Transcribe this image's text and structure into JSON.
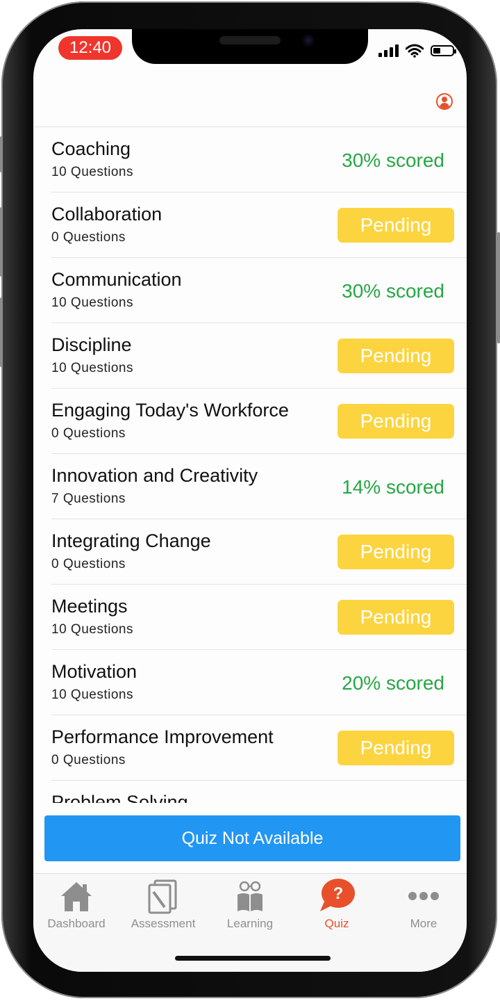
{
  "status_bar": {
    "time": "12:40"
  },
  "header": {
    "profile_icon": "user-circle-icon"
  },
  "quizzes": [
    {
      "title": "Coaching",
      "questions": "10 Questions",
      "status": "30% scored",
      "kind": "score"
    },
    {
      "title": "Collaboration",
      "questions": "0 Questions",
      "status": "Pending",
      "kind": "pending"
    },
    {
      "title": "Communication",
      "questions": "10 Questions",
      "status": "30% scored",
      "kind": "score"
    },
    {
      "title": "Discipline",
      "questions": "10 Questions",
      "status": "Pending",
      "kind": "pending"
    },
    {
      "title": "Engaging Today's Workforce",
      "questions": "0 Questions",
      "status": "Pending",
      "kind": "pending"
    },
    {
      "title": "Innovation and Creativity",
      "questions": "7 Questions",
      "status": "14% scored",
      "kind": "score"
    },
    {
      "title": "Integrating Change",
      "questions": "0 Questions",
      "status": "Pending",
      "kind": "pending"
    },
    {
      "title": "Meetings",
      "questions": "10 Questions",
      "status": "Pending",
      "kind": "pending"
    },
    {
      "title": "Motivation",
      "questions": "10 Questions",
      "status": "20% scored",
      "kind": "score"
    },
    {
      "title": "Performance Improvement",
      "questions": "0 Questions",
      "status": "Pending",
      "kind": "pending"
    },
    {
      "title": "Problem Solving",
      "questions": "",
      "status": "",
      "kind": "none"
    }
  ],
  "quiz_button": {
    "label": "Quiz Not Available"
  },
  "tabs": [
    {
      "label": "Dashboard",
      "icon": "house-icon"
    },
    {
      "label": "Assessment",
      "icon": "documents-icon"
    },
    {
      "label": "Learning",
      "icon": "book-glasses-icon"
    },
    {
      "label": "Quiz",
      "icon": "question-bubble-icon",
      "active": true
    },
    {
      "label": "More",
      "icon": "more-dots-icon"
    }
  ],
  "colors": {
    "score_green": "#26a744",
    "pending_yellow": "#fcd440",
    "accent_orange": "#e8502b",
    "button_blue": "#2196f3",
    "tab_gray": "#8e8e8e"
  }
}
